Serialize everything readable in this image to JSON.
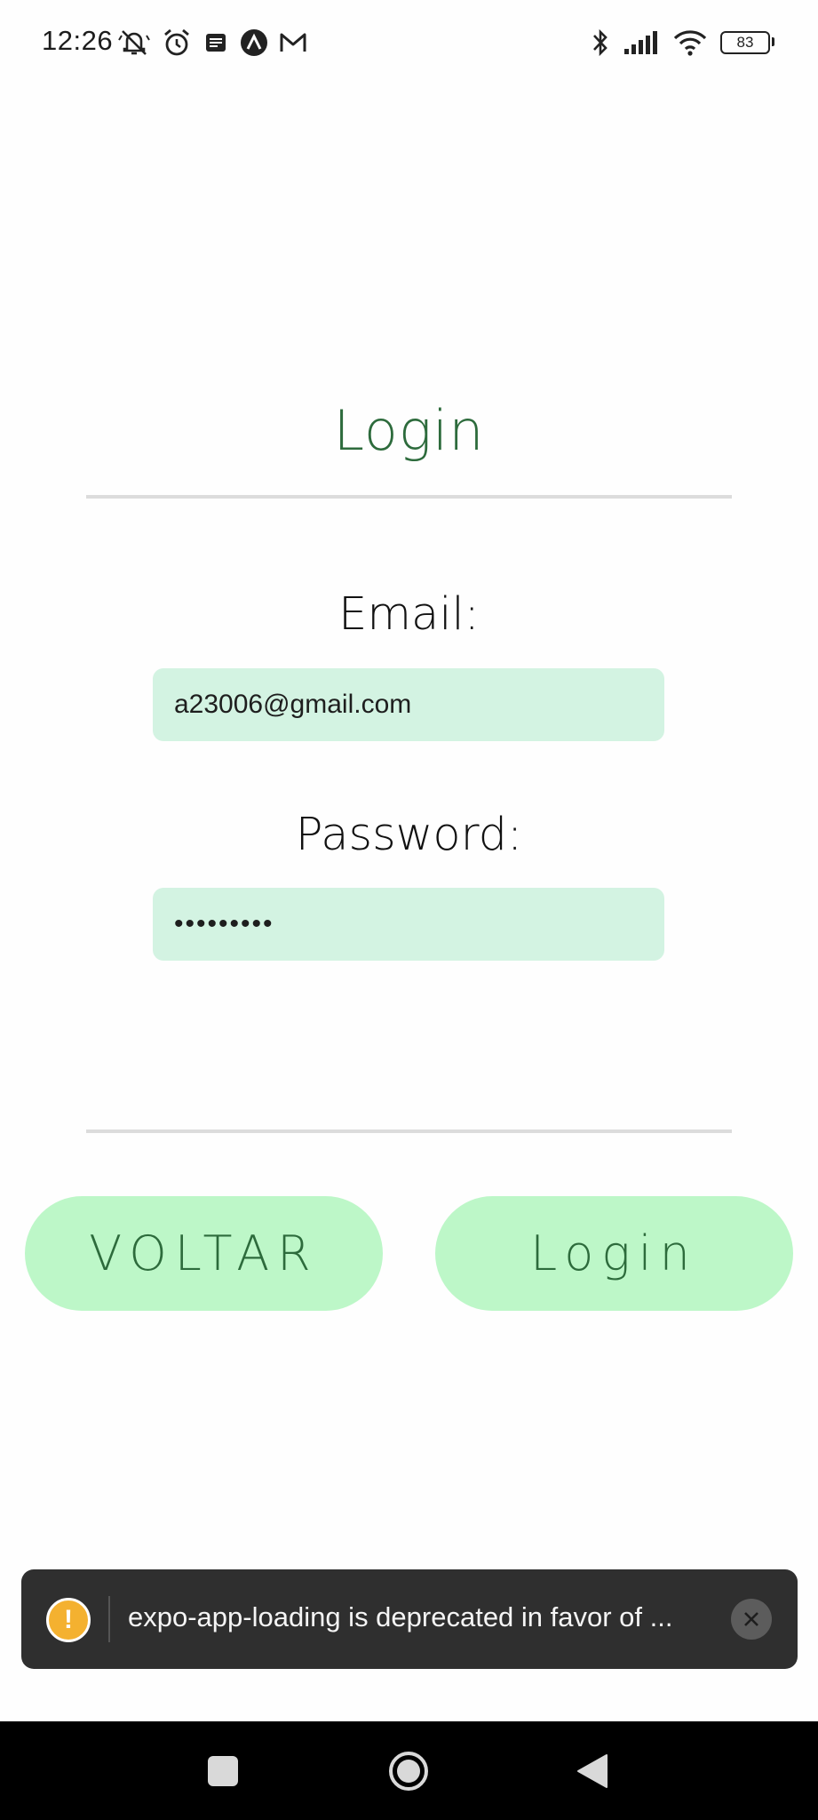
{
  "status_bar": {
    "time": "12:26",
    "left_icons": [
      "bell-off-icon",
      "alarm-icon",
      "notes-icon",
      "app-a-icon",
      "gmail-icon"
    ],
    "right_icons": [
      "bluetooth-icon",
      "signal-icon",
      "wifi-icon",
      "battery-icon"
    ],
    "battery": "83"
  },
  "login": {
    "title": "Login",
    "email_label": "Email:",
    "email_value": "a23006@gmail.com",
    "password_label": "Password:",
    "password_value": "•••••••••"
  },
  "buttons": {
    "back_label": "VOLTAR",
    "login_label": "Login"
  },
  "toast": {
    "icon": "warning-icon",
    "message": "expo-app-loading is deprecated in favor of ..."
  },
  "nav_bar": {
    "buttons": [
      "recent-apps-icon",
      "home-icon",
      "back-icon"
    ]
  },
  "colors": {
    "accent": "#2d6b3c",
    "input_bg": "#d3f3e2",
    "button_bg": "#bdf7c8",
    "toast_bg": "#2f2f2f",
    "warning": "#f4b130"
  }
}
